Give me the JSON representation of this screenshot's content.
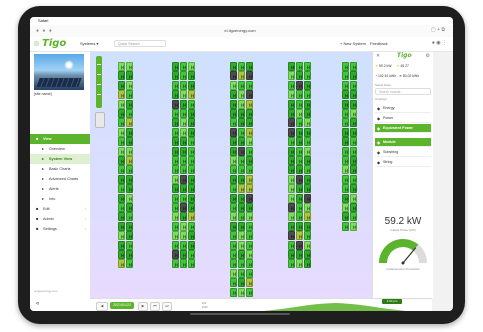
{
  "os": {
    "status_text": "Safari"
  },
  "browser": {
    "url": "ei.tigoenergy.com",
    "tab_count_label": "19"
  },
  "app": {
    "logo": "Tigo",
    "systems_label": "Systems ▾",
    "search_placeholder": "Quick Search",
    "new_system_label": "+ New System",
    "feedback_label": "Feedback",
    "notification_count": "1"
  },
  "sidebar": {
    "site_name": "[site name]",
    "nav": [
      {
        "label": "View",
        "icon": "eye-icon",
        "active": true
      },
      {
        "label": "Overview",
        "icon": "overview-icon",
        "sub": true
      },
      {
        "label": "System View",
        "icon": "system-view-icon",
        "sub": true,
        "selected": true
      },
      {
        "label": "Basic Charts",
        "icon": "chart-icon",
        "sub": true
      },
      {
        "label": "Advanced Charts",
        "icon": "chart-icon",
        "sub": true
      },
      {
        "label": "Alerts",
        "icon": "alert-icon",
        "sub": true
      },
      {
        "label": "Info",
        "icon": "info-icon",
        "sub": true
      },
      {
        "label": "Edit",
        "icon": "edit-icon",
        "chevron": true
      },
      {
        "label": "Admin",
        "icon": "admin-icon",
        "chevron": true
      },
      {
        "label": "Settings",
        "icon": "settings-icon",
        "chevron": true
      }
    ],
    "footer": "ei.tigoenergy.com",
    "collapse_label": "«"
  },
  "timeline": {
    "date": "2021/01/22",
    "time_badge": "1:00 pm",
    "scale_label_top": "kW",
    "scale_label_bottom": "kWh"
  },
  "right_panel": {
    "logo": "Tigo",
    "stat_row_1": [
      "59.2 kW",
      "45.27"
    ],
    "stat_row_2": [
      "102.51 kWh",
      "80.02 kWh"
    ],
    "search_placeholder": "Search module...",
    "section_label_1": "Select Data",
    "section_label_2": "Overlays",
    "menu": [
      {
        "label": "Energy",
        "icon": "energy-icon"
      },
      {
        "label": "Power",
        "icon": "power-icon"
      },
      {
        "label": "Equivalent Power",
        "icon": "equivalent-icon",
        "active": true
      }
    ],
    "menu2": [
      {
        "label": "Module",
        "icon": "module-icon",
        "active": true
      },
      {
        "label": "Substring",
        "icon": "substring-icon"
      },
      {
        "label": "String",
        "icon": "string-icon"
      }
    ],
    "power_value": "59.2 kW",
    "power_sub": "Instant Power (kW)",
    "gauge_fraction": 0.72,
    "gauge_caption": "Instantaneous Production"
  },
  "colors": {
    "brand_green": "#5cb32c",
    "panel_green": "#43c83a",
    "panel_dark": "#4d4d4d"
  },
  "panel_layout": {
    "blocks": [
      {
        "rows": 22,
        "cols": 2,
        "dark_ratio": 0.05
      },
      {
        "rows": 22,
        "cols": 3,
        "dark_ratio": 0.08
      },
      {
        "rows": 25,
        "cols": 3,
        "dark_ratio": 0.06
      },
      {
        "rows": 22,
        "cols": 3,
        "dark_ratio": 0.1
      },
      {
        "rows": 18,
        "cols": 2,
        "dark_ratio": 0.04
      }
    ]
  }
}
